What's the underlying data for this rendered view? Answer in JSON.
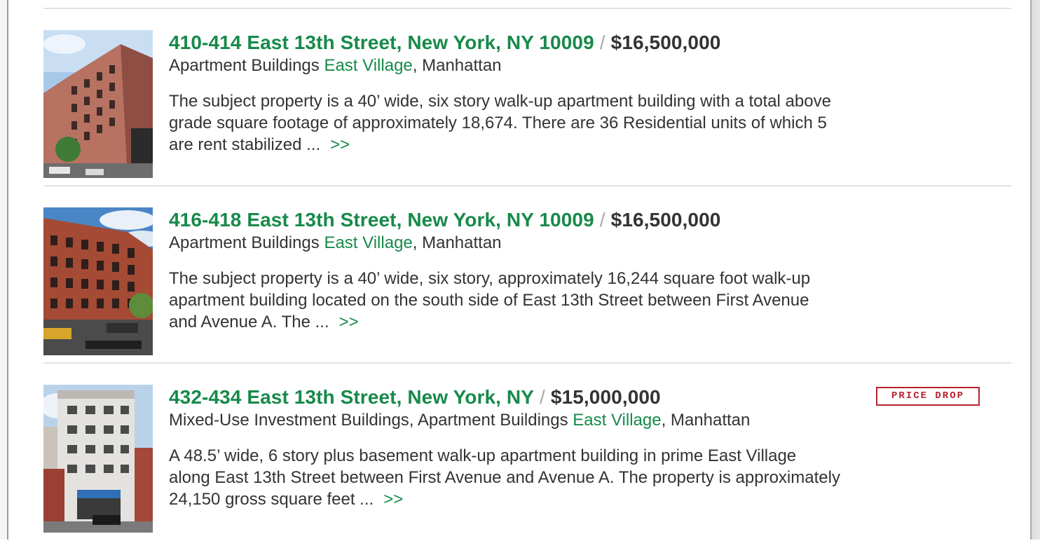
{
  "listings": [
    {
      "address": "410-414 East 13th Street, New York, NY 10009",
      "separator": "/",
      "price": "$16,500,000",
      "category": "Apartment Buildings",
      "neighborhood": "East Village",
      "borough_suffix": ", Manhattan",
      "description": "The subject property is a 40’ wide, six story walk-up apartment building with a total above grade square footage of approximately 18,674. There are 36 Residential units of which 5 are rent stabilized ...",
      "more": ">>",
      "thumbnail": "brick-walkup-photo"
    },
    {
      "address": "416-418 East 13th Street, New York, NY 10009",
      "separator": "/",
      "price": "$16,500,000",
      "category": "Apartment Buildings",
      "neighborhood": "East Village",
      "borough_suffix": ", Manhattan",
      "description": "The subject property is a 40’ wide, six story, approximately 16,244 square foot walk-up apartment building located on the south side of East 13th Street between First Avenue and Avenue A. The ...",
      "more": ">>",
      "thumbnail": "red-brick-building-photo"
    },
    {
      "address": "432-434 East 13th Street, New York, NY",
      "separator": "/",
      "price": "$15,000,000",
      "category": "Mixed-Use Investment Buildings, Apartment Buildings",
      "neighborhood": "East Village",
      "borough_suffix": ", Manhattan",
      "description": "A 48.5’ wide, 6 story plus basement walk-up apartment building in prime East Village along East 13th Street between First Avenue and Avenue A. The property is approximately 24,150 gross square feet ...",
      "more": ">>",
      "badge": "PRICE DROP",
      "thumbnail": "white-tower-building-photo"
    }
  ],
  "colors": {
    "link_green": "#178a4a",
    "text": "#333333",
    "badge_red": "#b8232c",
    "divider": "#e2e2e2"
  }
}
